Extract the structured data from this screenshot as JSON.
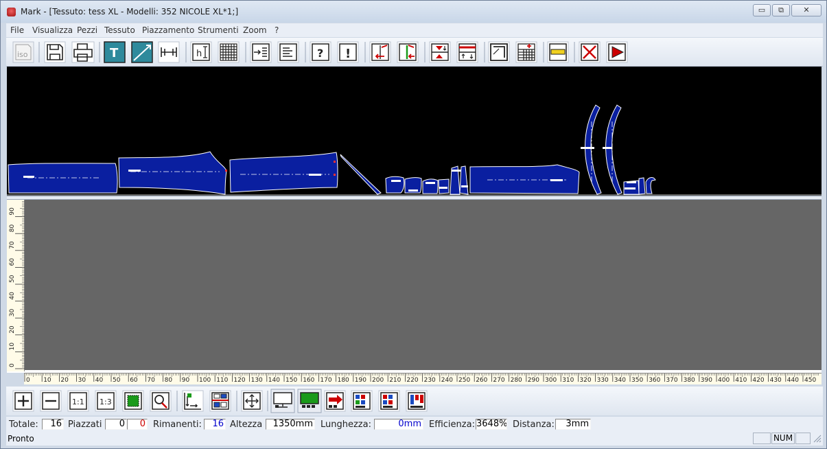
{
  "window": {
    "title": "Mark - [Tessuto: tess XL - Modelli: 352 NICOLE XL*1;]",
    "minimize_label": "▭",
    "restore_label": "⧉",
    "close_label": "✕"
  },
  "menu": {
    "items": [
      "File",
      "Visualizza",
      "Pezzi",
      "Tessuto",
      "Piazzamento",
      "Strumenti",
      "Zoom",
      "?"
    ]
  },
  "toolbar_top": {
    "buttons": [
      {
        "name": "iso-icon",
        "glyph": "iso",
        "enabled": false
      },
      {
        "name": "save-icon",
        "glyph": ""
      },
      {
        "name": "print-icon",
        "glyph": ""
      },
      {
        "name": "text-tool-icon",
        "glyph": "T"
      },
      {
        "name": "rotate-tool-icon",
        "glyph": ""
      },
      {
        "name": "measure-tool-icon",
        "glyph": "H"
      },
      {
        "name": "height-icon",
        "glyph": "h"
      },
      {
        "name": "grid-icon",
        "glyph": ""
      },
      {
        "name": "insert-list-icon",
        "glyph": ""
      },
      {
        "name": "list-icon",
        "glyph": ""
      },
      {
        "name": "help-icon",
        "glyph": "?"
      },
      {
        "name": "alert-icon",
        "glyph": "!"
      },
      {
        "name": "align-right-icon",
        "glyph": ""
      },
      {
        "name": "align-left-icon",
        "glyph": ""
      },
      {
        "name": "flip-vertical-icon",
        "glyph": ""
      },
      {
        "name": "flip-horizontal-icon",
        "glyph": ""
      },
      {
        "name": "corner-icon",
        "glyph": ""
      },
      {
        "name": "table-icon",
        "glyph": ""
      },
      {
        "name": "ruler-icon",
        "glyph": ""
      },
      {
        "name": "delete-icon",
        "glyph": "✕"
      },
      {
        "name": "run-icon",
        "glyph": "▶"
      }
    ]
  },
  "vertical_ruler": {
    "labels": [
      "0",
      "10",
      "20",
      "30",
      "40",
      "50",
      "60",
      "70",
      "80",
      "90"
    ]
  },
  "horizontal_ruler": {
    "labels": [
      "0",
      "10",
      "20",
      "30",
      "40",
      "50",
      "60",
      "70",
      "80",
      "90",
      "100",
      "110",
      "120",
      "130",
      "140",
      "150",
      "160",
      "170",
      "180",
      "190",
      "200",
      "210",
      "220",
      "230",
      "240",
      "250",
      "260",
      "270",
      "280",
      "290",
      "300",
      "310",
      "320",
      "330",
      "340",
      "350",
      "360",
      "370",
      "380",
      "390",
      "400",
      "410",
      "420",
      "430",
      "440",
      "450"
    ]
  },
  "toolbar_bottom": {
    "buttons": [
      {
        "name": "zoom-in-icon",
        "glyph": "+"
      },
      {
        "name": "zoom-out-icon",
        "glyph": "−"
      },
      {
        "name": "zoom-1-1-icon",
        "glyph": "1:1"
      },
      {
        "name": "zoom-1-3-icon",
        "glyph": "1:3"
      },
      {
        "name": "fit-fabric-icon",
        "glyph": ""
      },
      {
        "name": "magnifier-icon",
        "glyph": ""
      },
      {
        "name": "move-bottom-icon",
        "glyph": ""
      },
      {
        "name": "split-icon",
        "glyph": ""
      },
      {
        "name": "pan-icon",
        "glyph": "✥"
      },
      {
        "name": "view-marker-icon",
        "glyph": ""
      },
      {
        "name": "view-green-icon",
        "glyph": ""
      },
      {
        "name": "send-red-icon",
        "glyph": ""
      },
      {
        "name": "layout-a-icon",
        "glyph": ""
      },
      {
        "name": "layout-b-icon",
        "glyph": ""
      },
      {
        "name": "layout-c-icon",
        "glyph": ""
      }
    ]
  },
  "status": {
    "totale_label": "Totale:",
    "totale_value": "16",
    "piazzati_label": "Piazzati",
    "piazzati_value": "0",
    "piazzati_red": "0",
    "rimanenti_label": "Rimanenti:",
    "rimanenti_value": "16",
    "altezza_label": "Altezza",
    "altezza_value": "1350mm",
    "lunghezza_label": "Lunghezza:",
    "lunghezza_value": "0mm",
    "efficienza_label": "Efficienza:",
    "efficienza_value": "3648%",
    "distanza_label": "Distanza:",
    "distanza_value": "3mm"
  },
  "bottom": {
    "status_text": "Pronto",
    "num_label": "NUM"
  },
  "colors": {
    "piece_fill": "#0a1fa0",
    "piece_stroke": "#ffffff",
    "marker_bg": "#000000",
    "canvas_bg": "#666666",
    "accent_blue": "#0000cc",
    "accent_red": "#cc0000"
  }
}
